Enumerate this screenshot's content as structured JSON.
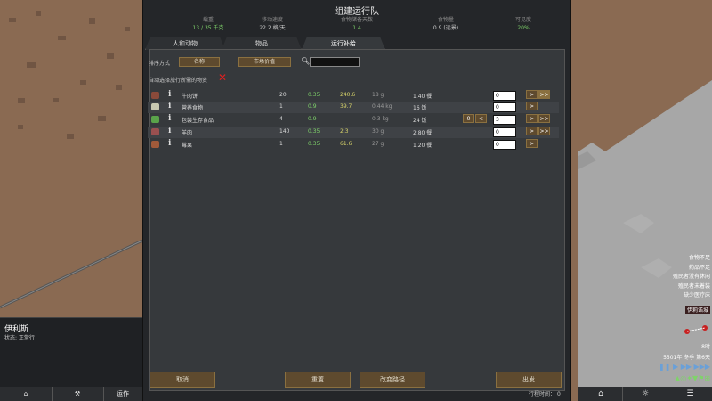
{
  "dialog": {
    "title": "组建运行队",
    "stats": [
      {
        "label": "载重",
        "value": "13 / 35 千克"
      },
      {
        "label": "移动速度",
        "value": "22.2 格/天"
      },
      {
        "label": "食物储备天数",
        "value": "1.4"
      },
      {
        "label": "食物量",
        "value": "0.9 (远景)"
      },
      {
        "label": "可见度",
        "value": "20%"
      }
    ],
    "tabs": [
      "人和动物",
      "物品",
      "运行补给"
    ],
    "filter_label": "排序方式",
    "sort_a": "名称",
    "sort_b": "市场价值",
    "auto_label": "自动选择旅行所需的物资",
    "buttons": {
      "cancel": "取消",
      "reset": "重置",
      "suggest": "改变路径",
      "accept": "出发"
    },
    "travel_time_label": "行程时间：",
    "travel_time_value": "0"
  },
  "items": [
    {
      "name": "牛肉饼",
      "count": "20",
      "mass": "0.35",
      "value": "240.6",
      "weight": "18 g",
      "days": "1.40 餐",
      "qty": "0",
      "icon_color": "#8a4a3a"
    },
    {
      "name": "营养食物",
      "count": "1",
      "mass": "0.9",
      "value": "39.7",
      "weight": "0.44 kg",
      "days": "16 饭",
      "qty": "0",
      "icon_color": "#c8c8b0"
    },
    {
      "name": "包装生存食品",
      "count": "4",
      "mass": "0.9",
      "value": "",
      "weight": "0.3 kg",
      "days": "24 饭",
      "qty": "3",
      "icon_color": "#5aa34a"
    },
    {
      "name": "羊肉",
      "count": "140",
      "mass": "0.35",
      "value": "2.3",
      "weight": "30 g",
      "days": "2.80 餐",
      "qty": "0",
      "icon_color": "#9a5050"
    },
    {
      "name": "莓果",
      "count": "1",
      "mass": "0.35",
      "value": "61.6",
      "weight": "27 g",
      "days": "1.20 餐",
      "qty": "0",
      "icon_color": "#a05a3a"
    }
  ],
  "pawn": {
    "name": "伊利斯",
    "status": "状态: 正常行"
  },
  "bottom_left": [
    "",
    "",
    "运作"
  ],
  "alerts": [
    "食物不足",
    "药品不足",
    "殖民者没有休闲",
    "殖民者未着装",
    "缺少医疗床"
  ],
  "map_label": "伊莉诺城",
  "date_time": {
    "time": "8时",
    "date": "5501年 冬季 第6天"
  }
}
